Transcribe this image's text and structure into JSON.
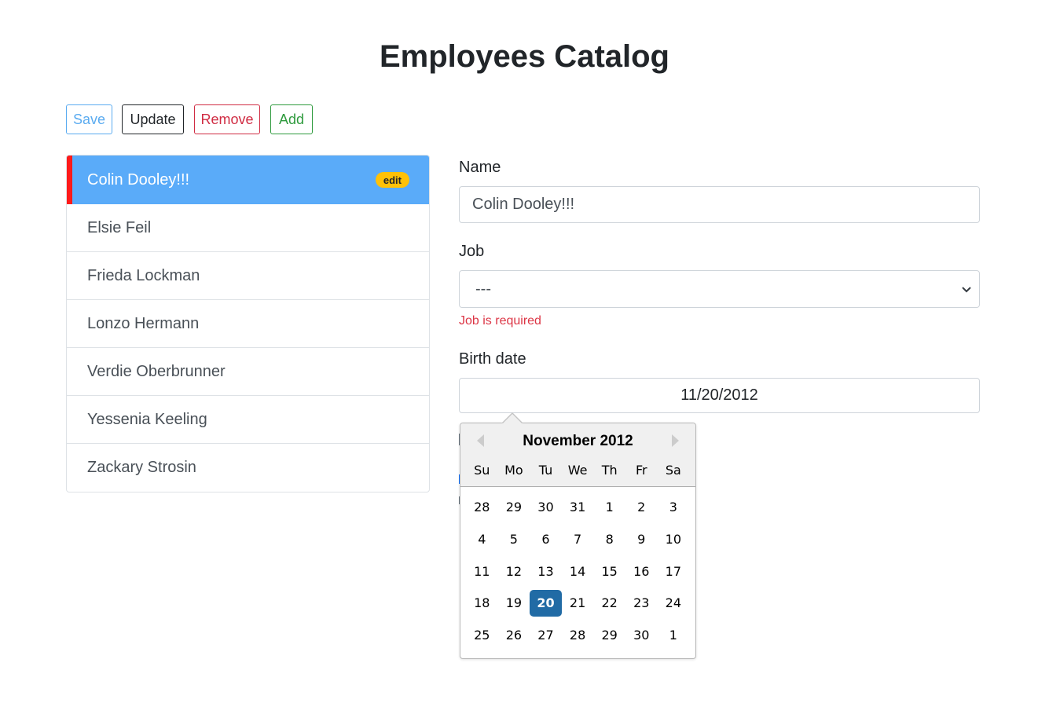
{
  "page": {
    "title": "Employees Catalog"
  },
  "toolbar": {
    "save": "Save",
    "update": "Update",
    "remove": "Remove",
    "add": "Add"
  },
  "employees": [
    {
      "name": "Colin Dooley!!!",
      "badge": "edit"
    },
    {
      "name": "Elsie Feil"
    },
    {
      "name": "Frieda Lockman"
    },
    {
      "name": "Lonzo Hermann"
    },
    {
      "name": "Verdie Oberbrunner"
    },
    {
      "name": "Yessenia Keeling"
    },
    {
      "name": "Zackary Strosin"
    }
  ],
  "form": {
    "name_label": "Name",
    "name_value": "Colin Dooley!!!",
    "job_label": "Job",
    "job_value": "---",
    "job_error": "Job is required",
    "birth_label": "Birth date",
    "birth_value": "11/20/2012"
  },
  "datepicker": {
    "month": "November 2012",
    "weekdays": [
      "Su",
      "Mo",
      "Tu",
      "We",
      "Th",
      "Fr",
      "Sa"
    ],
    "weeks": [
      [
        "28",
        "29",
        "30",
        "31",
        "1",
        "2",
        "3"
      ],
      [
        "4",
        "5",
        "6",
        "7",
        "8",
        "9",
        "10"
      ],
      [
        "11",
        "12",
        "13",
        "14",
        "15",
        "16",
        "17"
      ],
      [
        "18",
        "19",
        "20",
        "21",
        "22",
        "23",
        "24"
      ],
      [
        "25",
        "26",
        "27",
        "28",
        "29",
        "30",
        "1"
      ]
    ],
    "selected": "20"
  },
  "colors": {
    "active_item": "#5aabf9",
    "active_marker": "#ff1a1a",
    "badge": "#ffc107",
    "selected_day": "#216ba5",
    "error": "#dc3545"
  }
}
